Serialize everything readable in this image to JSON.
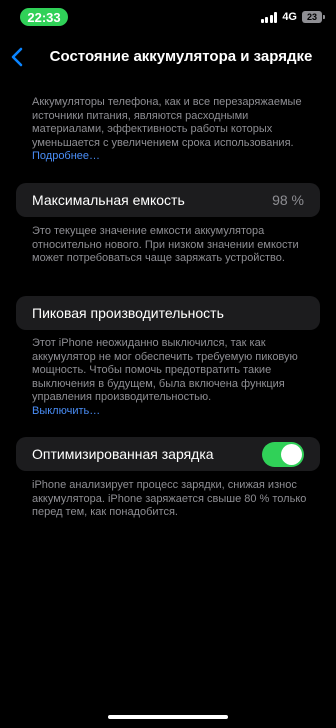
{
  "status_bar": {
    "time": "22:33",
    "network": "4G",
    "battery_level": "23"
  },
  "nav": {
    "title": "Состояние аккумулятора и зарядке"
  },
  "intro": {
    "text": "Аккумуляторы телефона, как и все перезаряжаемые источники питания, являются расходными материалами, эффективность работы которых уменьшается с увеличением срока использования.",
    "link": "Подробнее…"
  },
  "max_capacity": {
    "label": "Максимальная емкость",
    "value": "98 %",
    "footnote": "Это текущее значение емкости аккумулятора относительно нового. При низком значении емкости может потребоваться чаще заряжать устройство."
  },
  "peak_performance": {
    "label": "Пиковая производительность",
    "footnote": "Этот iPhone неожиданно выключился, так как аккумулятор не мог обеспечить требуемую пиковую мощность. Чтобы помочь предотвратить такие выключения в будущем, была включена функция управления производительностью.",
    "link": "Выключить…"
  },
  "optimized_charging": {
    "label": "Оптимизированная зарядка",
    "enabled": true,
    "footnote": "iPhone анализирует процесс зарядки, снижая износ аккумулятора. iPhone заряжается свыше 80 % только перед тем, как понадобится."
  },
  "colors": {
    "accent_green": "#30d158",
    "link_blue": "#4a8ef7",
    "cell_bg": "#1c1c1e",
    "secondary_text": "#8e8e93"
  }
}
